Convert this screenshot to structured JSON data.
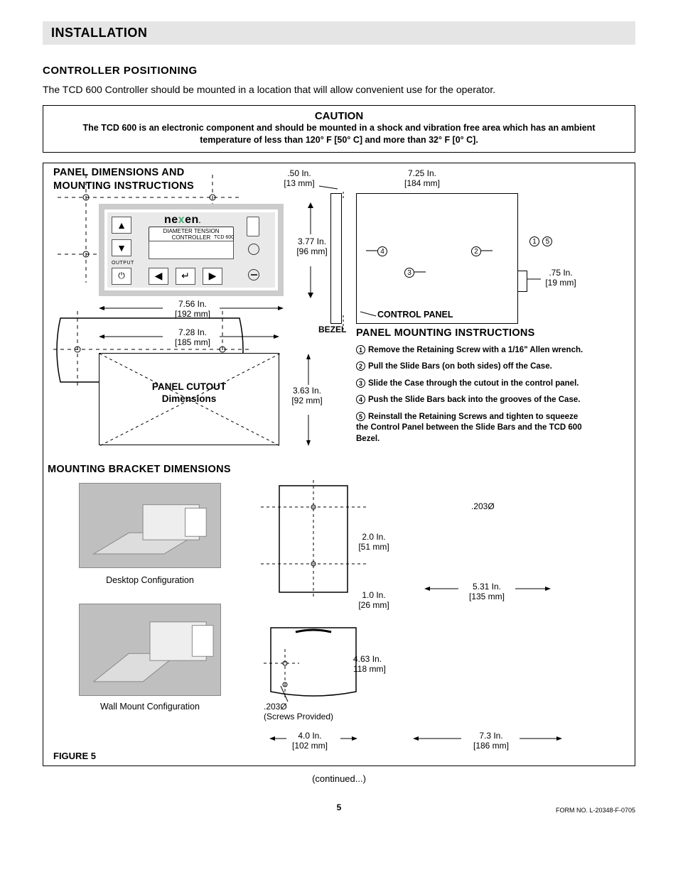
{
  "section": "INSTALLATION",
  "sub1": "CONTROLLER POSITIONING",
  "intro": "The TCD 600 Controller should be mounted in a location that will allow convenient use for the operator.",
  "caution": {
    "title": "CAUTION",
    "body": "The TCD 600 is an electronic component and should be mounted in a shock and vibration free area which has an ambient temperature of less than 120° F [50° C] and more than 32° F [0° C]."
  },
  "panel": {
    "title1": "PANEL DIMENSIONS AND",
    "title2": "MOUNTING INSTRUCTIONS",
    "brand": "nexen",
    "sublabel": "DIAMETER TENSION CONTROLLER",
    "model": "TCD 600",
    "output": "OUTPUT",
    "cutout_title1": "PANEL CUTOUT",
    "cutout_title2": "Dimensions",
    "bezel_label": "BEZEL",
    "control_panel_label": "CONTROL PANEL",
    "dim_50in": ".50 In.",
    "dim_50mm": "[13 mm]",
    "dim_725in": "7.25 In.",
    "dim_725mm": "[184 mm]",
    "dim_377in": "3.77 In.",
    "dim_377mm": "[96 mm]",
    "dim_75in": ".75 In.",
    "dim_75mm": "[19 mm]",
    "dim_756in": "7.56 In.",
    "dim_756mm": "[192 mm]",
    "dim_728in": "7.28 In.",
    "dim_728mm": "[185 mm]",
    "dim_363in": "3.63 In.",
    "dim_363mm": "[92 mm]"
  },
  "mounting": {
    "title": "PANEL MOUNTING INSTRUCTIONS",
    "steps": [
      "Remove the Retaining Screw with a 1/16\" Allen wrench.",
      "Pull the Slide Bars (on both sides) off the Case.",
      "Slide the Case through the cutout  in the control panel.",
      "Push the Slide Bars back into the grooves of the Case.",
      "Reinstall the Retaining Screws and tighten to squeeze the Control Panel between the Slide Bars and the TCD 600 Bezel."
    ]
  },
  "bracket": {
    "title": "MOUNTING BRACKET DIMENSIONS",
    "config1": "Desktop Configuration",
    "config2": "Wall Mount Configuration",
    "hole_dia": ".203Ø",
    "screws_note": "(Screws Provided)",
    "dim_20in": "2.0 In.",
    "dim_20mm": "[51 mm]",
    "dim_10in": "1.0 In.",
    "dim_10mm": "[26 mm]",
    "dim_463in": "4.63 In.",
    "dim_463mm": "118 mm]",
    "dim_40in": "4.0 In.",
    "dim_40mm": "[102 mm]",
    "dim_531in": "5.31 In.",
    "dim_531mm": "[135 mm]",
    "dim_73in": "7.3 In.",
    "dim_73mm": "[186 mm]"
  },
  "figure_label": "FIGURE 5",
  "continued": "(continued...)",
  "page_num": "5",
  "form_no": "FORM NO. L-20348-F-0705"
}
